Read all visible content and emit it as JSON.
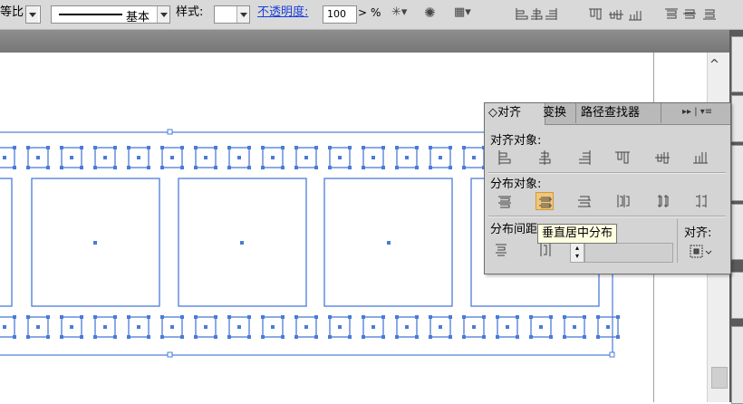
{
  "toolbar": {
    "ratio_label": "等比",
    "stroke_profile_label": "基本",
    "style_label": "样式:",
    "opacity_label": "不透明度:",
    "opacity_value": "100",
    "opacity_arrow": ">",
    "percent_sign": "%"
  },
  "panel": {
    "tabs": [
      "对齐",
      "变换",
      "路径查找器"
    ],
    "tab_prefix": "◇",
    "menu_glyph": "▸▸ | ▾≡",
    "align_objects_label": "对齐对象:",
    "distribute_objects_label": "分布对象:",
    "distribute_spacing_label": "分布间距",
    "align_to_label": "对齐:",
    "tooltip": "垂直居中分布"
  },
  "colors": {
    "selection_blue": "#4a7bd9",
    "highlight": "#f3c77a",
    "panel_bg": "#d4d4d4",
    "toolbar_bg": "#d9d9d9"
  }
}
